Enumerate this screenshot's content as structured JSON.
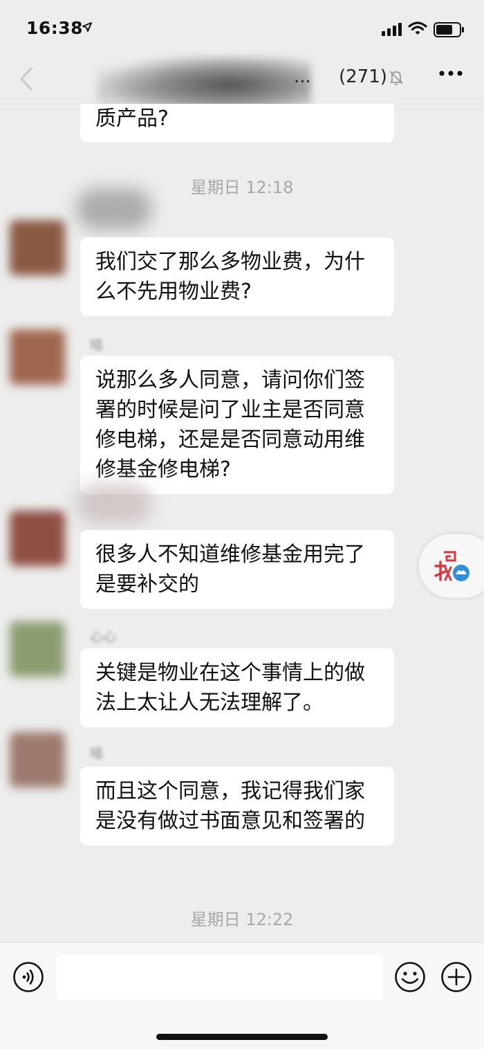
{
  "status_bar": {
    "time": "16:38"
  },
  "nav": {
    "title": "...",
    "member_count": "(271)"
  },
  "messages": [
    {
      "text": "质产品?"
    },
    {
      "text": "我们交了那么多物业费，为什么不先用物业费?"
    },
    {
      "sender": "喵",
      "text": "说那么多人同意，请问你们签署的时候是问了业主是否同意修电梯，还是是否同意动用维修基金修电梯?"
    },
    {
      "text": "很多人不知道维修基金用完了是要补交的"
    },
    {
      "sender": "心心",
      "text": "关键是物业在这个事情上的做法上太让人无法理解了。"
    },
    {
      "sender": "喵",
      "text": "而且这个同意，我记得我们家是没有做过书面意见和签署的"
    }
  ],
  "timestamps": [
    "星期日 12:18",
    "星期日 12:22"
  ],
  "input": {
    "placeholder": ""
  },
  "icons": {
    "back": "chevron-left-icon",
    "mute": "bell-off-icon",
    "more": "more-dots-icon",
    "voice": "voice-icon",
    "emoji": "emoji-icon",
    "plus": "plus-icon"
  },
  "colors": {
    "background": "#ededed",
    "bubble": "#ffffff",
    "timestamp": "#a8a8a8"
  }
}
